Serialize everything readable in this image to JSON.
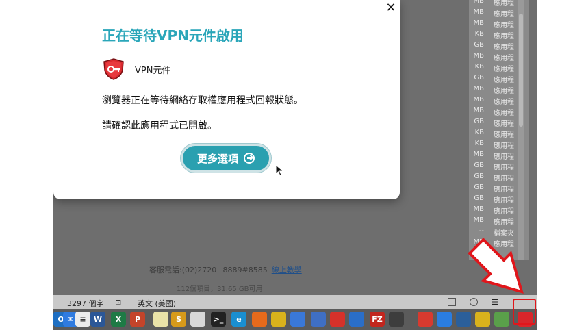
{
  "modal": {
    "title": "正在等待VPN元件啟用",
    "component_name": "VPN元件",
    "message1": "瀏覽器正在等待網絡存取權應用程式回報狀態。",
    "message2": "請確認此應用程式已開啟。",
    "more_button": "更多選項",
    "close_glyph": "✕"
  },
  "background": {
    "support_text": "客服電話:(02)2720−8889#8585",
    "support_link": "線上教學",
    "finder_status": "112個項目，31.65 GB可用"
  },
  "file_list": [
    {
      "size": "MB",
      "kind": "應用程"
    },
    {
      "size": "MB",
      "kind": "應用程"
    },
    {
      "size": "MB",
      "kind": "應用程"
    },
    {
      "size": "KB",
      "kind": "應用程"
    },
    {
      "size": "GB",
      "kind": "應用程"
    },
    {
      "size": "MB",
      "kind": "應用程"
    },
    {
      "size": "KB",
      "kind": "應用程"
    },
    {
      "size": "GB",
      "kind": "應用程"
    },
    {
      "size": "MB",
      "kind": "應用程"
    },
    {
      "size": "MB",
      "kind": "應用程"
    },
    {
      "size": "MB",
      "kind": "應用程"
    },
    {
      "size": "GB",
      "kind": "應用程"
    },
    {
      "size": "KB",
      "kind": "應用程"
    },
    {
      "size": "KB",
      "kind": "應用程"
    },
    {
      "size": "MB",
      "kind": "應用程"
    },
    {
      "size": "GB",
      "kind": "應用程"
    },
    {
      "size": "GB",
      "kind": "應用程"
    },
    {
      "size": "GB",
      "kind": "應用程"
    },
    {
      "size": "GB",
      "kind": "應用程"
    },
    {
      "size": "MB",
      "kind": "應用程"
    },
    {
      "size": "MB",
      "kind": "應用程"
    },
    {
      "size": "--",
      "kind": "檔案夾"
    },
    {
      "size": "MB",
      "kind": "應用程"
    }
  ],
  "statusbar": {
    "word_count": "3297 個字",
    "language": "英文 (美國)"
  },
  "dock": {
    "items": [
      {
        "label": "O",
        "color": "#1f6fc2"
      },
      {
        "label": "✉",
        "color": "#2f7be0"
      },
      {
        "label": "≡",
        "color": "#ececec"
      },
      {
        "label": "W",
        "color": "#2b5797"
      },
      {
        "label": "X",
        "color": "#1e7a45"
      },
      {
        "label": "P",
        "color": "#c4442a"
      },
      {
        "label": "",
        "color": "#e9e2a8"
      },
      {
        "label": "S",
        "color": "#d79a1a"
      },
      {
        "label": "",
        "color": "#d8d8d8"
      },
      {
        "label": ">_",
        "color": "#222222"
      },
      {
        "label": "e",
        "color": "#1a8fd1"
      },
      {
        "label": "",
        "color": "#e56a1c"
      },
      {
        "label": "",
        "color": "#d9b21c"
      },
      {
        "label": "",
        "color": "#3a78d8"
      },
      {
        "label": "",
        "color": "#3f6fc4"
      },
      {
        "label": "",
        "color": "#d6312a"
      },
      {
        "label": "",
        "color": "#2a6ec8"
      },
      {
        "label": "FZ",
        "color": "#c2261e"
      },
      {
        "label": "",
        "color": "#3d3d3d"
      },
      {
        "label": "",
        "color": "#d73a2f"
      },
      {
        "label": "",
        "color": "#2a7de1"
      },
      {
        "label": "",
        "color": "#2b5f9a"
      },
      {
        "label": "",
        "color": "#d9b21c"
      },
      {
        "label": "",
        "color": "#5aa04a"
      },
      {
        "label": "",
        "color": "#d9252a"
      }
    ]
  },
  "colors": {
    "accent": "#2aa6b9",
    "button": "#2aa0b0",
    "annotation": "#e0161b"
  }
}
